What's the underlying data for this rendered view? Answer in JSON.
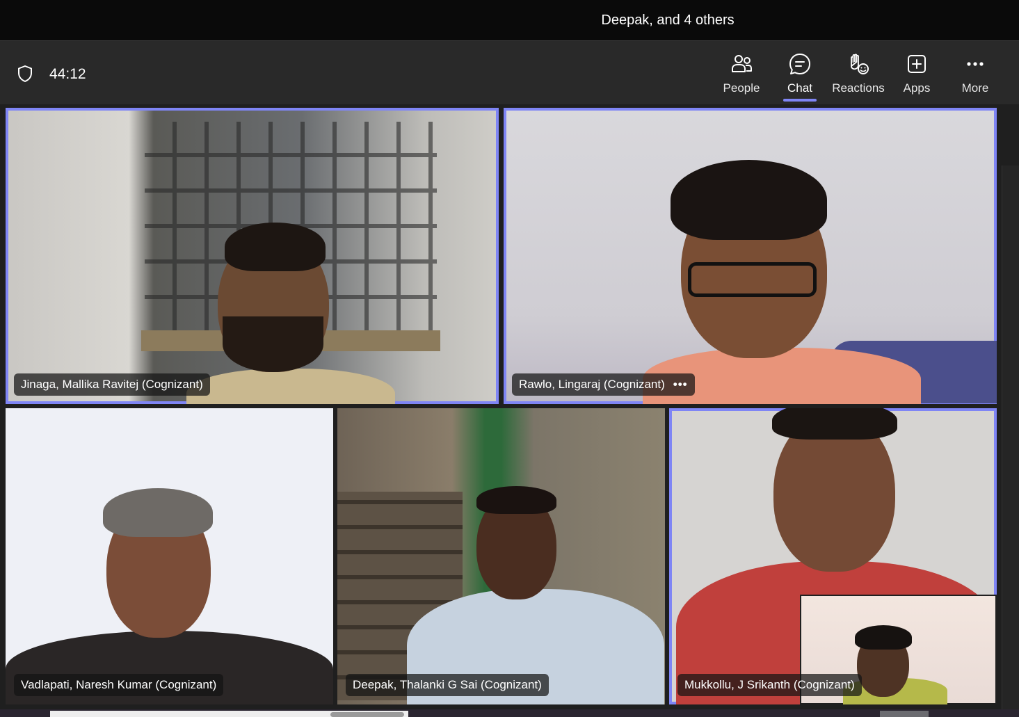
{
  "window": {
    "title": "Deepak, and 4 others"
  },
  "toolbar": {
    "timer": "44:12",
    "buttons": [
      {
        "label": "People",
        "icon": "people-icon"
      },
      {
        "label": "Chat",
        "icon": "chat-icon",
        "active": true
      },
      {
        "label": "Reactions",
        "icon": "reactions-icon"
      },
      {
        "label": "Apps",
        "icon": "apps-icon"
      },
      {
        "label": "More",
        "icon": "more-icon"
      }
    ]
  },
  "participants": [
    {
      "name": "Jinaga, Mallika Ravitej (Cognizant)",
      "speaking": true
    },
    {
      "name": "Rawlo, Lingaraj (Cognizant)",
      "speaking": true,
      "more": "•••"
    },
    {
      "name": "Vadlapati, Naresh Kumar (Cognizant)",
      "speaking": false
    },
    {
      "name": "Deepak, Thalanki G Sai (Cognizant)",
      "speaking": false
    },
    {
      "name": "Mukkollu, J Srikanth (Cognizant)",
      "speaking": true
    }
  ],
  "colors": {
    "accent": "#7f85f5",
    "titlebar": "#0a0a0a",
    "toolbar": "#292929"
  }
}
